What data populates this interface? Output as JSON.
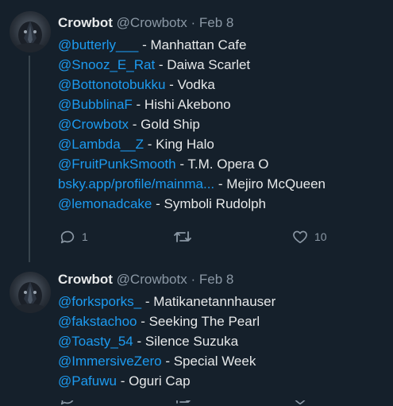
{
  "tweets": [
    {
      "name": "Crowbot",
      "handle": "@Crowbotx",
      "separator": "·",
      "date": "Feb 8",
      "lines": [
        {
          "mention": "@butterly___",
          "text": " - Manhattan Cafe"
        },
        {
          "mention": "@Snooz_E_Rat",
          "text": " - Daiwa Scarlet"
        },
        {
          "mention": "@Bottonotobukku",
          "text": " - Vodka"
        },
        {
          "mention": "@BubblinaF",
          "text": " - Hishi Akebono"
        },
        {
          "mention": "@Crowbotx",
          "text": " - Gold Ship"
        },
        {
          "mention": "@Lambda__Z",
          "text": " - King Halo"
        },
        {
          "mention": "@FruitPunkSmooth",
          "text": " - T.M. Opera O"
        },
        {
          "mention": "bsky.app/profile/mainma...",
          "text": " - Mejiro McQueen"
        },
        {
          "mention": "@lemonadcake",
          "text": " - Symboli Rudolph"
        }
      ],
      "actions": {
        "reply_count": "1",
        "retweet_count": "",
        "like_count": "10"
      }
    },
    {
      "name": "Crowbot",
      "handle": "@Crowbotx",
      "separator": "·",
      "date": "Feb 8",
      "lines": [
        {
          "mention": "@forksporks_",
          "text": " - Matikanetannhauser"
        },
        {
          "mention": "@fakstachoo",
          "text": " - Seeking The Pearl"
        },
        {
          "mention": "@Toasty_54",
          "text": " - Silence Suzuka"
        },
        {
          "mention": "@ImmersiveZero",
          "text": " - Special Week"
        },
        {
          "mention": "@Pafuwu",
          "text": " - Oguri Cap"
        }
      ]
    }
  ],
  "icons": {
    "reply": "reply-icon",
    "retweet": "retweet-icon",
    "like": "heart-icon"
  },
  "colors": {
    "background": "#15202b",
    "text": "#e7e9ea",
    "secondary": "#8b98a5",
    "link": "#1d9bf0",
    "thread_line": "#38444d"
  }
}
